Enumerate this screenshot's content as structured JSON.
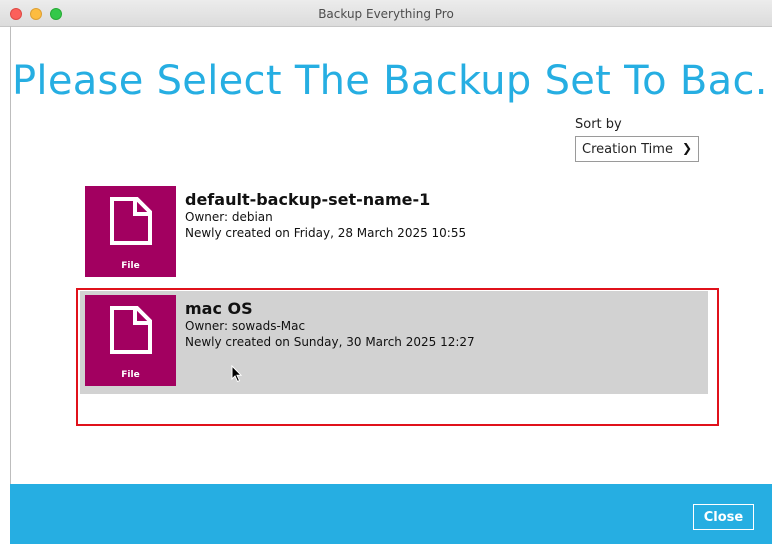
{
  "window": {
    "title": "Backup Everything Pro"
  },
  "main": {
    "heading": "Please Select The Backup Set To Bac..."
  },
  "sort": {
    "label": "Sort by",
    "selected": "Creation Time"
  },
  "backup_sets": [
    {
      "name": "default-backup-set-name-1",
      "owner": "Owner: debian",
      "created": "Newly created on Friday, 28 March 2025 10:55",
      "type": "File",
      "selected": false
    },
    {
      "name": "mac OS",
      "owner": "Owner: sowads-Mac",
      "created": "Newly created on Sunday, 30 March 2025 12:27",
      "type": "File",
      "selected": true
    }
  ],
  "footer": {
    "close_label": "Close"
  },
  "colors": {
    "accent": "#26aee2",
    "file_tile": "#a20060",
    "selection_highlight": "#e0111b"
  }
}
